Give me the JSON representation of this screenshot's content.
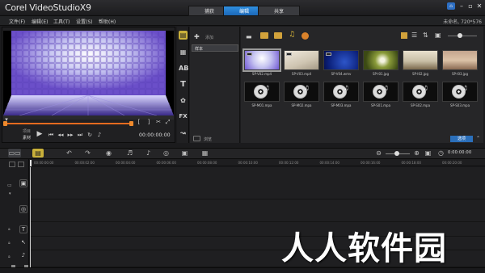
{
  "app": {
    "title": "Corel VideoStudioX9"
  },
  "tabs": [
    {
      "label": "捕获"
    },
    {
      "label": "编辑"
    },
    {
      "label": "共享"
    }
  ],
  "menu": [
    {
      "label": "文件(F)"
    },
    {
      "label": "编辑(E)"
    },
    {
      "label": "工具(T)"
    },
    {
      "label": "设置(S)"
    },
    {
      "label": "帮助(H)"
    }
  ],
  "project": {
    "info": "未命名, 720*576"
  },
  "player": {
    "mode_project": "项目",
    "mode_clip": "素材",
    "timecode": "00:00:00:00",
    "mark_in": "[",
    "mark_out": "]"
  },
  "library": {
    "add_label": "添加",
    "folder": "样本",
    "browse_label": "浏览",
    "options_label": "选项"
  },
  "media": [
    {
      "name": "SP-V02.mp4",
      "kind": "video-led"
    },
    {
      "name": "SP-V03.mp4",
      "kind": "video-beige"
    },
    {
      "name": "SP-V04.wmv",
      "kind": "video-blue"
    },
    {
      "name": "SP-I01.jpg",
      "kind": "image-dandelion"
    },
    {
      "name": "SP-I02.jpg",
      "kind": "image-sky"
    },
    {
      "name": "SP-I03.jpg",
      "kind": "image-tree"
    },
    {
      "name": "SP-M01.mpa",
      "kind": "audio"
    },
    {
      "name": "SP-M02.mpa",
      "kind": "audio"
    },
    {
      "name": "SP-M03.mpa",
      "kind": "audio"
    },
    {
      "name": "SP-S01.mpa",
      "kind": "audio"
    },
    {
      "name": "SP-S02.mpa",
      "kind": "audio"
    },
    {
      "name": "SP-S03.mpa",
      "kind": "audio"
    }
  ],
  "timeline": {
    "ruler": [
      "00:00:00:00",
      "00:00:02:00",
      "00:00:04:00",
      "00:00:06:00",
      "00:00:08:00",
      "00:00:10:00",
      "00:00:12:00",
      "00:00:14:00",
      "00:00:16:00",
      "00:00:18:00",
      "00:00:20:00"
    ],
    "duration": "0:00:00:00"
  },
  "watermark": {
    "text": "人人软件园"
  }
}
